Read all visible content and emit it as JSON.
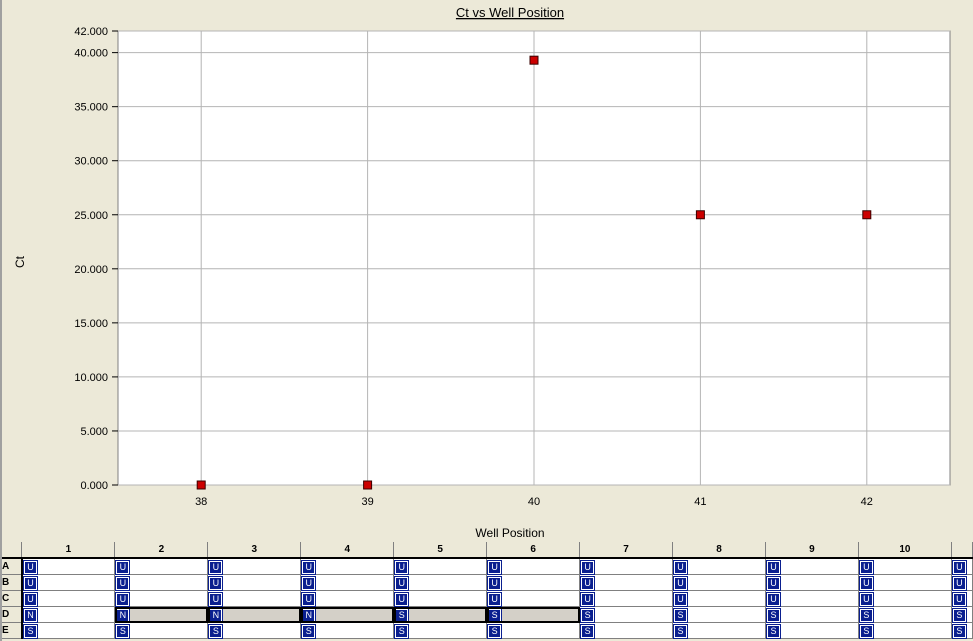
{
  "chart_data": {
    "type": "scatter",
    "title": "Ct vs Well Position",
    "xlabel": "Well Position",
    "ylabel": "Ct",
    "x": [
      38,
      39,
      40,
      41,
      42
    ],
    "y": [
      0.0,
      0.0,
      39.3,
      25.0,
      25.0
    ],
    "xlim": [
      37.5,
      42.5
    ],
    "ylim": [
      0,
      42
    ],
    "x_ticks": [
      "38",
      "39",
      "40",
      "41",
      "42"
    ],
    "y_ticks": [
      {
        "value": 0,
        "label": "0.000"
      },
      {
        "value": 5,
        "label": "5.000"
      },
      {
        "value": 10,
        "label": "10.000"
      },
      {
        "value": 15,
        "label": "15.000"
      },
      {
        "value": 20,
        "label": "20.000"
      },
      {
        "value": 25,
        "label": "25.000"
      },
      {
        "value": 30,
        "label": "30.000"
      },
      {
        "value": 35,
        "label": "35.000"
      },
      {
        "value": 40,
        "label": "40.000"
      },
      {
        "value": 42,
        "label": "42.000"
      }
    ],
    "grid": true,
    "marker_color": "#cc0000"
  },
  "plate": {
    "columns": [
      "1",
      "2",
      "3",
      "4",
      "5",
      "6",
      "7",
      "8",
      "9",
      "10",
      ""
    ],
    "rows": [
      {
        "label": "A",
        "wells": [
          "U",
          "U",
          "U",
          "U",
          "U",
          "U",
          "U",
          "U",
          "U",
          "U",
          "U"
        ]
      },
      {
        "label": "B",
        "wells": [
          "U",
          "U",
          "U",
          "U",
          "U",
          "U",
          "U",
          "U",
          "U",
          "U",
          "U"
        ]
      },
      {
        "label": "C",
        "wells": [
          "U",
          "U",
          "U",
          "U",
          "U",
          "U",
          "U",
          "U",
          "U",
          "U",
          "U"
        ]
      },
      {
        "label": "D",
        "wells": [
          "N",
          "N",
          "N",
          "N",
          "S",
          "S",
          "S",
          "S",
          "S",
          "S",
          "S"
        ],
        "selected": [
          1,
          2,
          3,
          4,
          5
        ]
      },
      {
        "label": "E",
        "wells": [
          "S",
          "S",
          "S",
          "S",
          "S",
          "S",
          "S",
          "S",
          "S",
          "S",
          "S"
        ]
      }
    ]
  }
}
